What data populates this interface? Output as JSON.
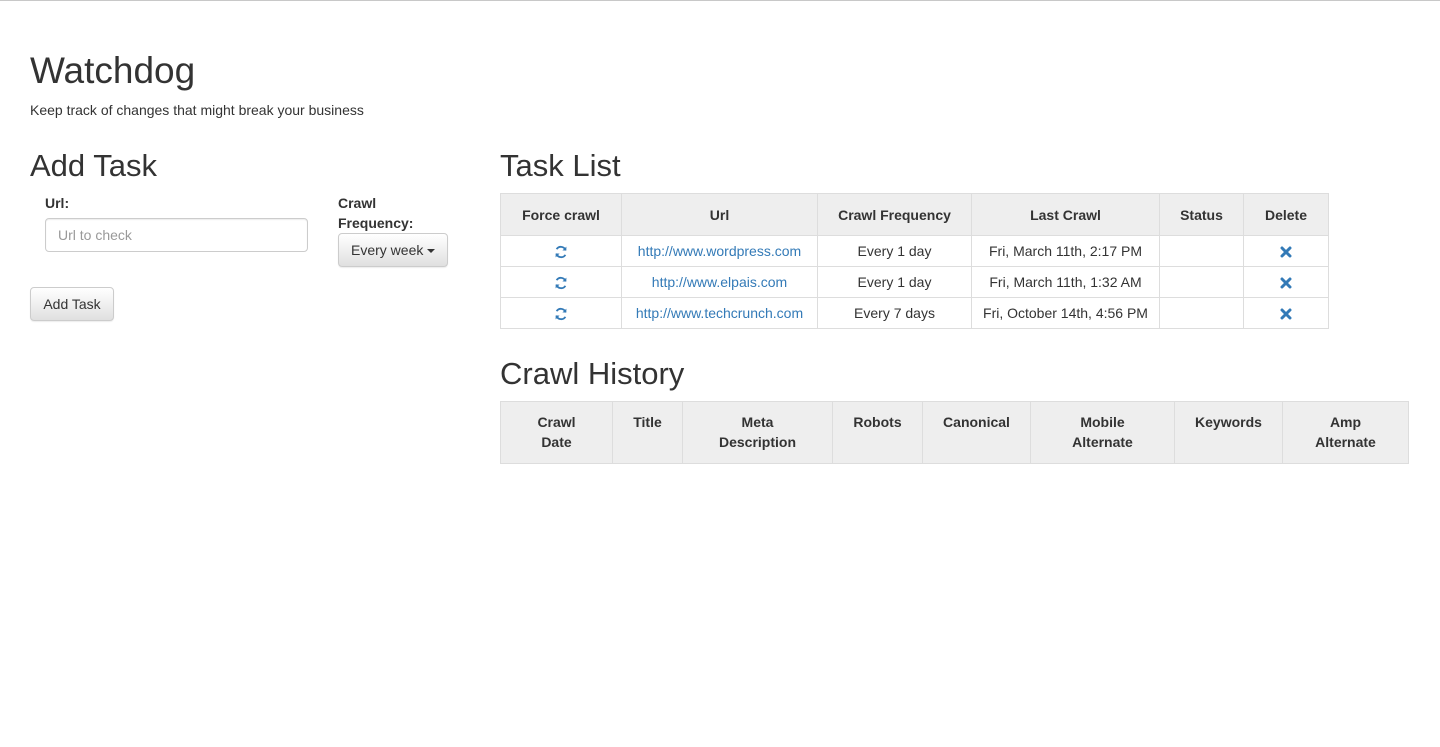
{
  "header": {
    "title": "Watchdog",
    "subtitle": "Keep track of changes that might break your business"
  },
  "add_task": {
    "heading": "Add Task",
    "url_label": "Url:",
    "url_value": "",
    "url_placeholder": "Url to check",
    "frequency_label": "Crawl Frequency:",
    "frequency_selected": "Every week",
    "submit_label": "Add Task"
  },
  "task_list": {
    "heading": "Task List",
    "columns": [
      "Force crawl",
      "Url",
      "Crawl Frequency",
      "Last Crawl",
      "Status",
      "Delete"
    ],
    "rows": [
      {
        "force_icon": "refresh-icon",
        "url": "http://www.wordpress.com",
        "frequency": "Every 1 day",
        "last_crawl": "Fri, March 11th, 2:17 PM",
        "status": "",
        "delete_icon": "remove-icon"
      },
      {
        "force_icon": "refresh-icon",
        "url": "http://www.elpais.com",
        "frequency": "Every 1 day",
        "last_crawl": "Fri, March 11th, 1:32 AM",
        "status": "",
        "delete_icon": "remove-icon"
      },
      {
        "force_icon": "refresh-icon",
        "url": "http://www.techcrunch.com",
        "frequency": "Every 7 days",
        "last_crawl": "Fri, October 14th, 4:56 PM",
        "status": "",
        "delete_icon": "remove-icon"
      }
    ]
  },
  "crawl_history": {
    "heading": "Crawl History",
    "columns": [
      [
        "Crawl",
        "Date"
      ],
      [
        "Title"
      ],
      [
        "Meta",
        "Description"
      ],
      [
        "Robots"
      ],
      [
        "Canonical"
      ],
      [
        "Mobile",
        "Alternate"
      ],
      [
        "Keywords"
      ],
      [
        "Amp",
        "Alternate"
      ]
    ],
    "rows": []
  },
  "colors": {
    "link": "#337ab7",
    "header_bg": "#eeeeee",
    "border": "#dddddd",
    "text": "#333333"
  }
}
